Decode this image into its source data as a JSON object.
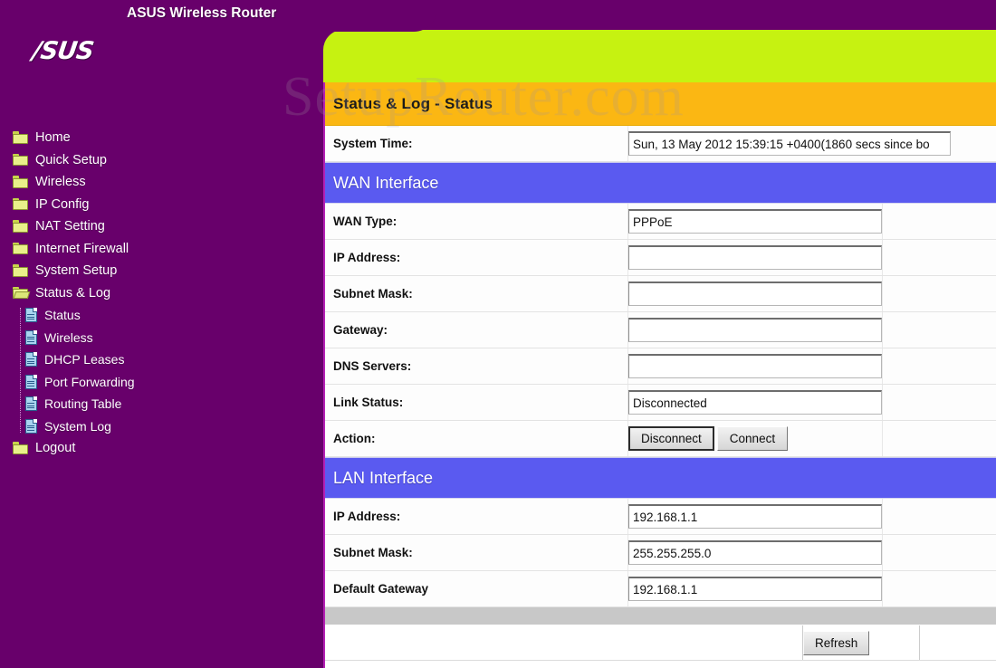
{
  "banner": {
    "title": "ASUS Wireless Router",
    "logo_text": "/SUS",
    "colors": {
      "purple": "#68006B",
      "green": "#c6f211",
      "orange": "#FBB713",
      "section_blue": "#5A5AF0"
    }
  },
  "watermark": {
    "text": "SetupRouter.com"
  },
  "sidebar": {
    "items": [
      {
        "label": "Home",
        "icon": "folder-icon",
        "level": 0,
        "state": "closed"
      },
      {
        "label": "Quick Setup",
        "icon": "folder-icon",
        "level": 0,
        "state": "closed"
      },
      {
        "label": "Wireless",
        "icon": "folder-icon",
        "level": 0,
        "state": "closed"
      },
      {
        "label": "IP Config",
        "icon": "folder-icon",
        "level": 0,
        "state": "closed"
      },
      {
        "label": "NAT Setting",
        "icon": "folder-icon",
        "level": 0,
        "state": "closed"
      },
      {
        "label": "Internet Firewall",
        "icon": "folder-icon",
        "level": 0,
        "state": "closed"
      },
      {
        "label": "System Setup",
        "icon": "folder-icon",
        "level": 0,
        "state": "closed"
      },
      {
        "label": "Status & Log",
        "icon": "folder-open-icon",
        "level": 0,
        "state": "open"
      },
      {
        "label": "Status",
        "icon": "document-icon",
        "level": 1,
        "state": "selected"
      },
      {
        "label": "Wireless",
        "icon": "document-icon",
        "level": 1,
        "state": "normal"
      },
      {
        "label": "DHCP Leases",
        "icon": "document-icon",
        "level": 1,
        "state": "normal"
      },
      {
        "label": "Port Forwarding",
        "icon": "document-icon",
        "level": 1,
        "state": "normal"
      },
      {
        "label": "Routing Table",
        "icon": "document-icon",
        "level": 1,
        "state": "normal"
      },
      {
        "label": "System Log",
        "icon": "document-icon",
        "level": 1,
        "state": "normal"
      },
      {
        "label": "Logout",
        "icon": "folder-icon",
        "level": 0,
        "state": "closed"
      }
    ]
  },
  "page": {
    "title": "Status & Log - Status",
    "system_time": {
      "label": "System Time:",
      "value": "Sun, 13 May 2012 15:39:15 +0400(1860 secs since bo"
    },
    "wan": {
      "section_title": "WAN Interface",
      "rows": [
        {
          "label": "WAN Type:",
          "value": "PPPoE"
        },
        {
          "label": "IP Address:",
          "value": ""
        },
        {
          "label": "Subnet Mask:",
          "value": ""
        },
        {
          "label": "Gateway:",
          "value": ""
        },
        {
          "label": "DNS Servers:",
          "value": ""
        },
        {
          "label": "Link Status:",
          "value": "Disconnected"
        }
      ],
      "action": {
        "label": "Action:",
        "disconnect_label": "Disconnect",
        "connect_label": "Connect"
      }
    },
    "lan": {
      "section_title": "LAN Interface",
      "rows": [
        {
          "label": "IP Address:",
          "value": "192.168.1.1"
        },
        {
          "label": "Subnet Mask:",
          "value": "255.255.255.0"
        },
        {
          "label": "Default Gateway",
          "value": "192.168.1.1"
        }
      ]
    },
    "footer": {
      "refresh_label": "Refresh"
    }
  }
}
